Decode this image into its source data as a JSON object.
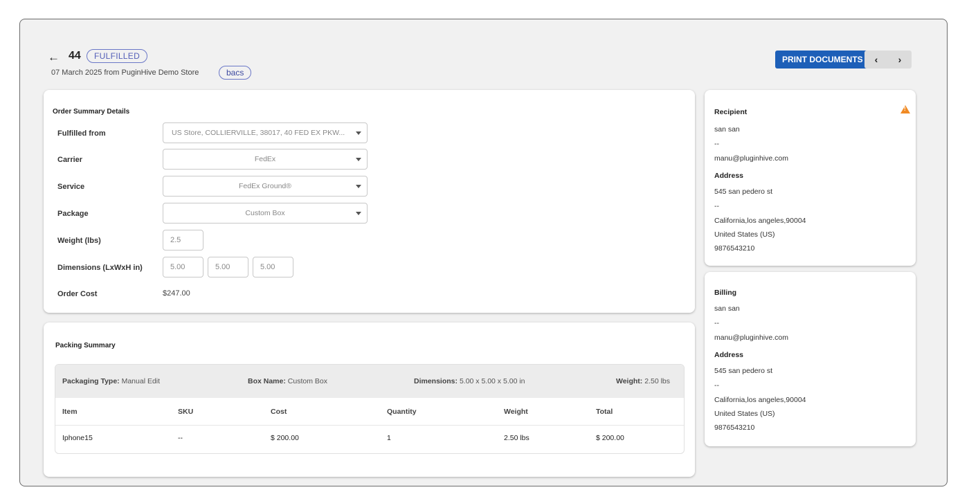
{
  "header": {
    "back_icon": "arrow-left-icon",
    "order_number": "44",
    "status": "FULFILLED",
    "subtitle": "07 March 2025 from PuginHive Demo Store",
    "payment_badge": "bacs",
    "print_label": "PRINT DOCUMENTS",
    "prev_icon": "‹",
    "next_icon": "›"
  },
  "summary": {
    "title": "Order Summary Details",
    "fulfilled_from_label": "Fulfilled from",
    "fulfilled_from_value": "US Store, COLLIERVILLE, 38017, 40 FED EX PKW...",
    "carrier_label": "Carrier",
    "carrier_value": "FedEx",
    "service_label": "Service",
    "service_value": "FedEx Ground®",
    "package_label": "Package",
    "package_value": "Custom Box",
    "weight_label": "Weight  (lbs)",
    "weight_value": "2.5",
    "dimensions_label": "Dimensions (LxWxH in)",
    "dim_l": "5.00",
    "dim_w": "5.00",
    "dim_h": "5.00",
    "order_cost_label": "Order Cost",
    "order_cost_value": "$247.00"
  },
  "packing": {
    "title": "Packing Summary",
    "packaging_type_label": "Packaging Type:",
    "packaging_type_value": "Manual Edit",
    "box_name_label": "Box Name:",
    "box_name_value": "Custom Box",
    "dimensions_label": "Dimensions:",
    "dimensions_value": "5.00 x 5.00 x 5.00 in",
    "weight_label": "Weight:",
    "weight_value": "2.50 lbs",
    "columns": [
      "Item",
      "SKU",
      "Cost",
      "Quantity",
      "Weight",
      "Total"
    ],
    "rows": [
      {
        "item": "Iphone15",
        "sku": "--",
        "cost": "$ 200.00",
        "quantity": "1",
        "weight": "2.50 lbs",
        "total": "$ 200.00"
      }
    ]
  },
  "recipient": {
    "title": "Recipient",
    "name": "san san",
    "phone_placeholder": "--",
    "email": "manu@pluginhive.com",
    "address_label": "Address",
    "address_line1": "545 san pedero st",
    "address_line2": "--",
    "city_line": "California,los angeles,90004",
    "country": "United States (US)",
    "phone": "9876543210",
    "warning_icon": "warning-triangle-icon"
  },
  "billing": {
    "title": "Billing",
    "name": "san san",
    "phone_placeholder": "--",
    "email": "manu@pluginhive.com",
    "address_label": "Address",
    "address_line1": "545 san pedero st",
    "address_line2": "--",
    "city_line": "California,los angeles,90004",
    "country": "United States (US)",
    "phone": "9876543210"
  },
  "colors": {
    "primary_button": "#1d5fb8",
    "status_badge": "#5560b8",
    "warning": "#f08a24"
  }
}
